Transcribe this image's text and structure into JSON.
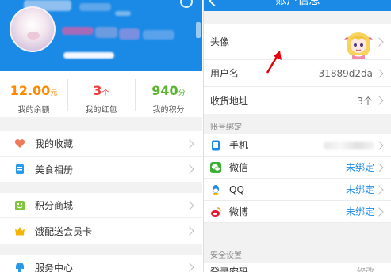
{
  "left": {
    "stats": [
      {
        "value": "12.00",
        "unit": "元",
        "label": "我的余额",
        "color": "#ff8a00"
      },
      {
        "value": "3",
        "unit": "个",
        "label": "我的红包",
        "color": "#f23c3c"
      },
      {
        "value": "940",
        "unit": "分",
        "label": "我的积分",
        "color": "#5cb531"
      }
    ],
    "menu_group1": [
      {
        "label": "我的收藏",
        "icon": "heart-icon"
      },
      {
        "label": "美食相册",
        "icon": "album-icon"
      }
    ],
    "menu_group2": [
      {
        "label": "积分商城",
        "icon": "shop-icon"
      },
      {
        "label": "饿配送会员卡",
        "icon": "crown-icon"
      }
    ],
    "menu_group3": [
      {
        "label": "服务中心",
        "icon": "service-icon"
      }
    ]
  },
  "right": {
    "nav_title": "账户信息",
    "info_rows": {
      "avatar_label": "头像",
      "username_label": "用户名",
      "username_value": "31889d2da",
      "address_label": "收货地址",
      "address_value": "3个"
    },
    "binding_section_label": "账号绑定",
    "bindings": [
      {
        "label": "手机",
        "status": "",
        "icon": "phone-icon",
        "color": "#1b8ae6"
      },
      {
        "label": "微信",
        "status": "未绑定",
        "icon": "wechat-icon",
        "color": "#3cb034"
      },
      {
        "label": "QQ",
        "status": "未绑定",
        "icon": "qq-icon",
        "color": "#1b8ae6"
      },
      {
        "label": "微博",
        "status": "未绑定",
        "icon": "weibo-icon",
        "color": "#e6162d"
      }
    ],
    "security_section_label": "安全设置",
    "security_row": {
      "label": "登录密码",
      "value": "修改"
    }
  },
  "colors": {
    "accent": "#1b8ae6",
    "annotation_arrow": "#e8000b"
  }
}
